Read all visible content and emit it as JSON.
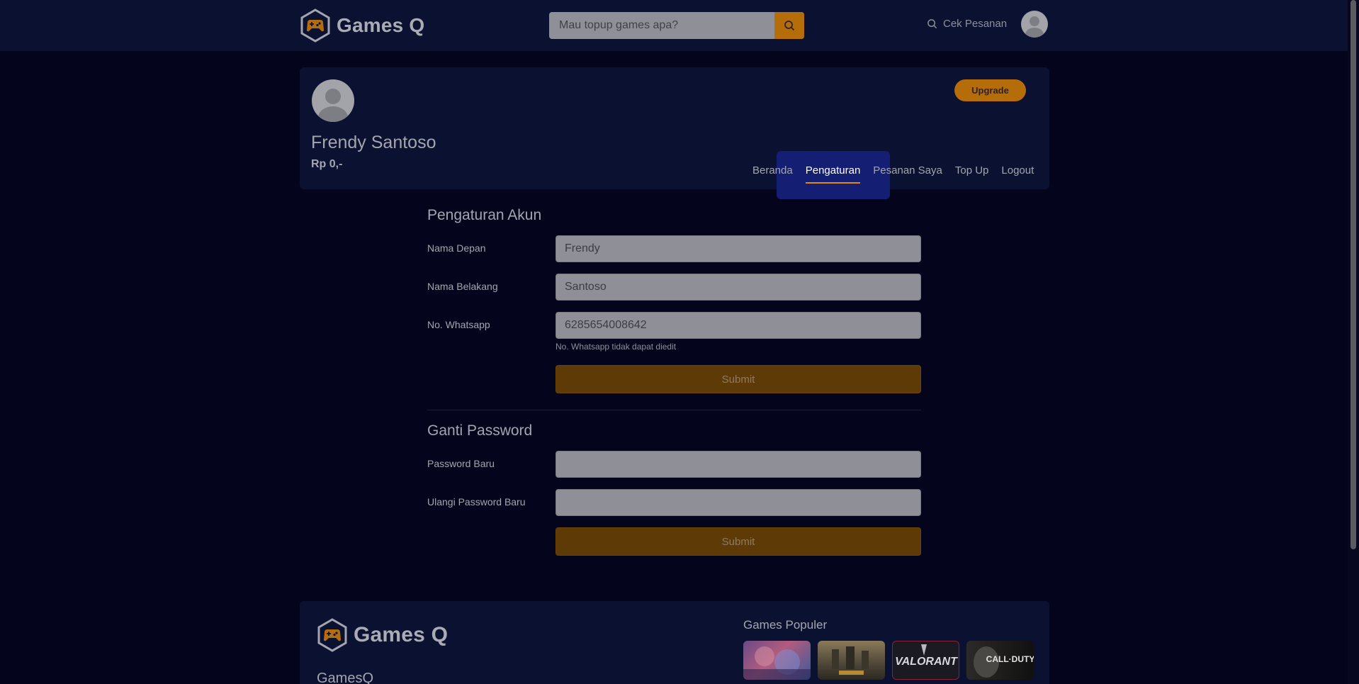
{
  "header": {
    "logo_text": "Games Q",
    "search_placeholder": "Mau topup games apa?",
    "cek_pesanan": "Cek Pesanan",
    "icons": [
      "gamepad-icon",
      "search-icon",
      "user-avatar-icon"
    ]
  },
  "profile": {
    "name": "Frendy Santoso",
    "balance": "Rp 0,-",
    "upgrade_label": "Upgrade",
    "nav": [
      {
        "label": "Beranda"
      },
      {
        "label": "Pengaturan"
      },
      {
        "label": "Pesanan Saya"
      },
      {
        "label": "Top Up"
      },
      {
        "label": "Logout"
      }
    ],
    "active_nav": "Pengaturan"
  },
  "account_settings": {
    "title": "Pengaturan Akun",
    "first_name_label": "Nama Depan",
    "first_name_value": "Frendy",
    "last_name_label": "Nama Belakang",
    "last_name_value": "Santoso",
    "whatsapp_label": "No. Whatsapp",
    "whatsapp_value": "6285654008642",
    "whatsapp_hint": "No. Whatsapp tidak dapat diedit",
    "submit_label": "Submit"
  },
  "change_password": {
    "title": "Ganti Password",
    "new_password_label": "Password Baru",
    "new_password_value": "",
    "repeat_password_label": "Ulangi Password Baru",
    "repeat_password_value": "",
    "submit_label": "Submit"
  },
  "footer": {
    "logo_text": "Games Q",
    "brand": "GamesQ",
    "games_title": "Games Populer",
    "games": [
      "mobile-legends-thumb",
      "pubg-thumb",
      "valorant-thumb",
      "call-of-duty-thumb"
    ],
    "valorant_text": "VALORANT",
    "cod_text": "CALL·DUTY"
  },
  "colors": {
    "background": "#04041d",
    "panel": "#0b1130",
    "accent": "#b46d08",
    "active_nav_bg": "#141e72"
  }
}
